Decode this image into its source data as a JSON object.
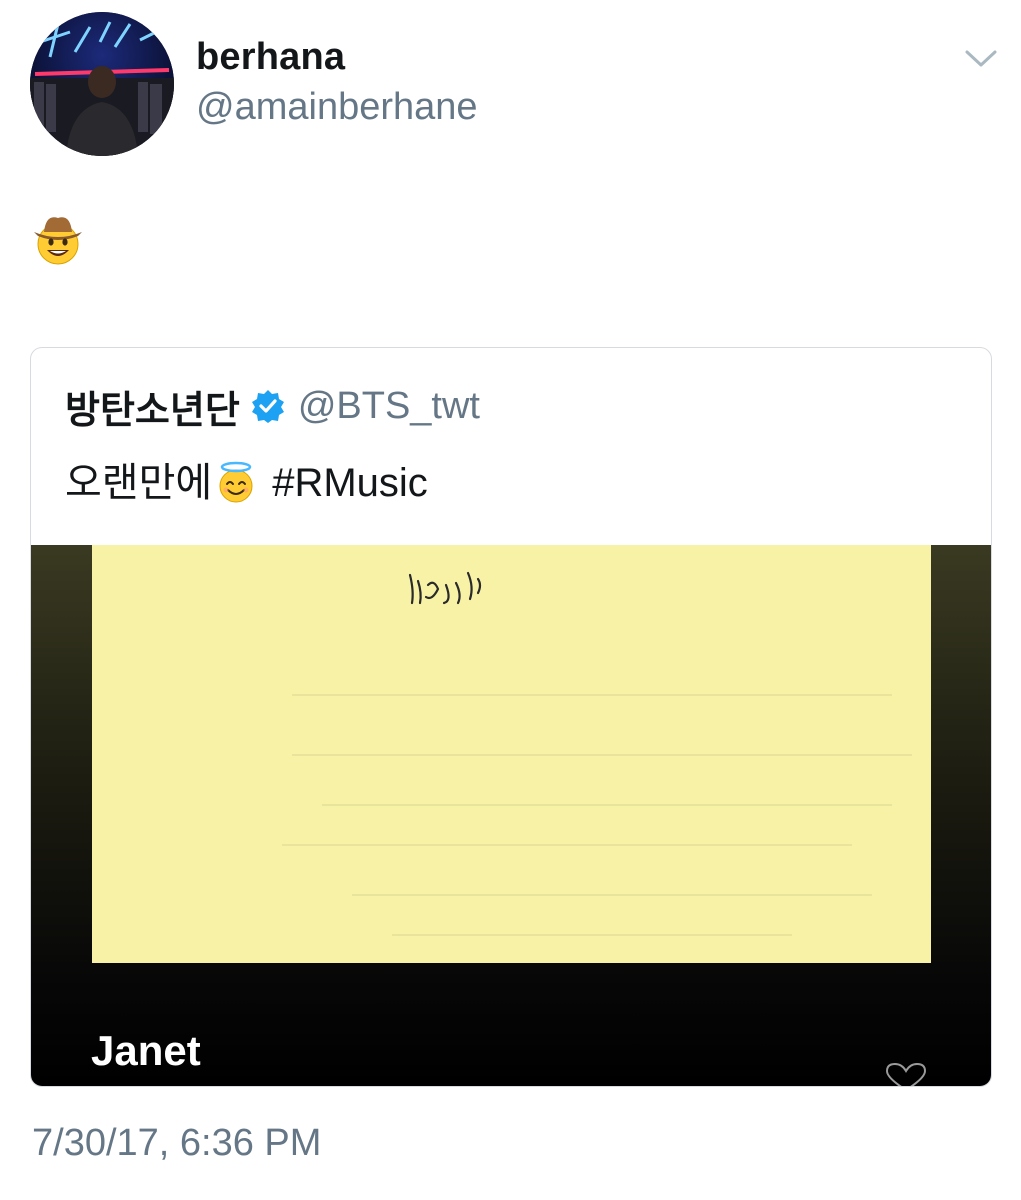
{
  "author": {
    "display_name": "berhana",
    "handle": "@amainberhane"
  },
  "tweet": {
    "text_emoji": "cowboy-hat-face-emoji"
  },
  "quoted": {
    "display_name": "방탄소년단",
    "handle": "@BTS_twt",
    "verified": true,
    "text_before_emoji": "오랜만에",
    "emoji": "smiling-face-with-halo-emoji",
    "hashtag": "#RMusic",
    "media_title": "Janet"
  },
  "timestamp": "7/30/17, 6:36 PM",
  "colors": {
    "verified_blue": "#1da1f2",
    "secondary_text": "#657786",
    "paper_yellow": "#f7f2a6"
  }
}
